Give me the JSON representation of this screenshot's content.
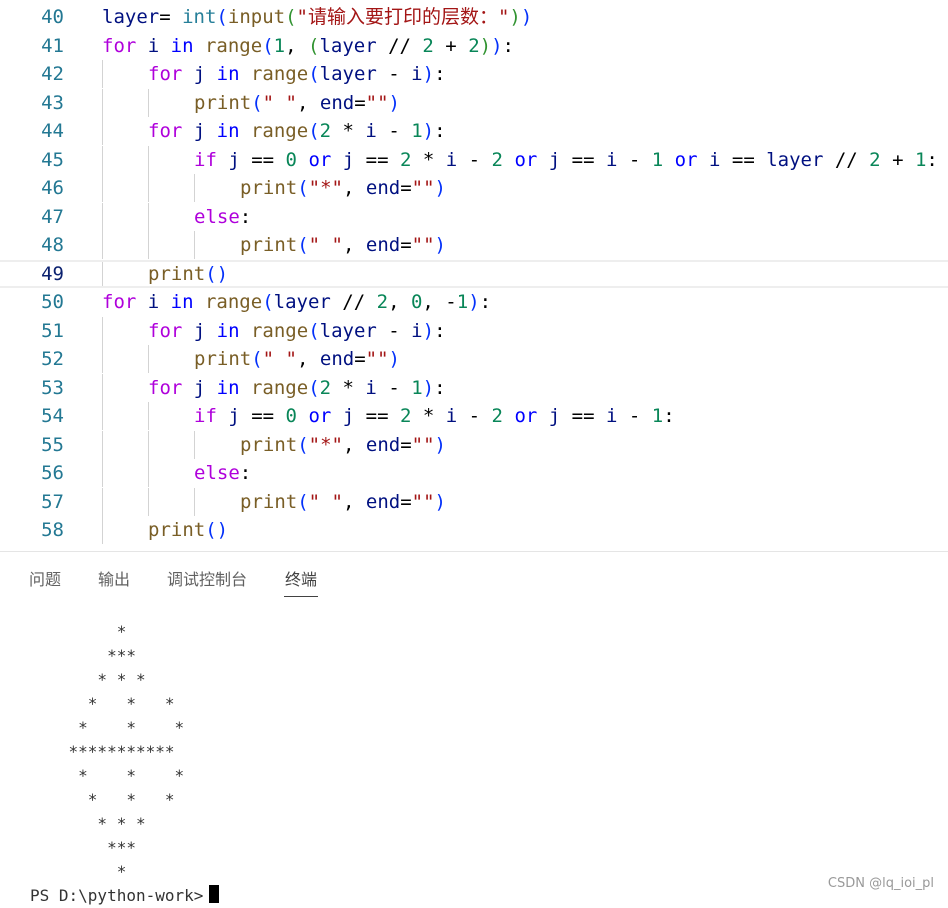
{
  "editor": {
    "current_line": "49",
    "lines": [
      {
        "n": "40",
        "indent": 0,
        "tokens": [
          [
            "vr",
            "layer"
          ],
          [
            "",
            "= "
          ],
          [
            "bi",
            "int"
          ],
          [
            "b1",
            "("
          ],
          [
            "fn",
            "input"
          ],
          [
            "b2",
            "("
          ],
          [
            "st",
            "\"请输入要打印的层数：\""
          ],
          [
            "b2",
            ")"
          ],
          [
            "b1",
            ")"
          ]
        ]
      },
      {
        "n": "41",
        "indent": 0,
        "tokens": [
          [
            "kw",
            "for "
          ],
          [
            "vr",
            "i "
          ],
          [
            "kf",
            "in "
          ],
          [
            "fn",
            "range"
          ],
          [
            "b1",
            "("
          ],
          [
            "nm",
            "1"
          ],
          [
            "",
            ", "
          ],
          [
            "b2",
            "("
          ],
          [
            "vr",
            "layer "
          ],
          [
            "",
            "// "
          ],
          [
            "nm",
            "2 "
          ],
          [
            "",
            "+ "
          ],
          [
            "nm",
            "2"
          ],
          [
            "b2",
            ")"
          ],
          [
            "b1",
            ")"
          ],
          [
            "",
            ":"
          ]
        ]
      },
      {
        "n": "42",
        "indent": 1,
        "tokens": [
          [
            "kw",
            "for "
          ],
          [
            "vr",
            "j "
          ],
          [
            "kf",
            "in "
          ],
          [
            "fn",
            "range"
          ],
          [
            "b1",
            "("
          ],
          [
            "vr",
            "layer "
          ],
          [
            "",
            "- "
          ],
          [
            "vr",
            "i"
          ],
          [
            "b1",
            ")"
          ],
          [
            "",
            ":"
          ]
        ]
      },
      {
        "n": "43",
        "indent": 2,
        "tokens": [
          [
            "fn",
            "print"
          ],
          [
            "b1",
            "("
          ],
          [
            "st",
            "\" \""
          ],
          [
            "",
            ", "
          ],
          [
            "vr",
            "end"
          ],
          [
            "",
            "="
          ],
          [
            "st",
            "\"\""
          ],
          [
            "b1",
            ")"
          ]
        ]
      },
      {
        "n": "44",
        "indent": 1,
        "tokens": [
          [
            "kw",
            "for "
          ],
          [
            "vr",
            "j "
          ],
          [
            "kf",
            "in "
          ],
          [
            "fn",
            "range"
          ],
          [
            "b1",
            "("
          ],
          [
            "nm",
            "2 "
          ],
          [
            "",
            "* "
          ],
          [
            "vr",
            "i "
          ],
          [
            "",
            "- "
          ],
          [
            "nm",
            "1"
          ],
          [
            "b1",
            ")"
          ],
          [
            "",
            ":"
          ]
        ]
      },
      {
        "n": "45",
        "indent": 2,
        "tokens": [
          [
            "kw",
            "if "
          ],
          [
            "vr",
            "j "
          ],
          [
            "",
            "== "
          ],
          [
            "nm",
            "0 "
          ],
          [
            "kf",
            "or "
          ],
          [
            "vr",
            "j "
          ],
          [
            "",
            "== "
          ],
          [
            "nm",
            "2 "
          ],
          [
            "",
            "* "
          ],
          [
            "vr",
            "i "
          ],
          [
            "",
            "- "
          ],
          [
            "nm",
            "2 "
          ],
          [
            "kf",
            "or "
          ],
          [
            "vr",
            "j "
          ],
          [
            "",
            "== "
          ],
          [
            "vr",
            "i "
          ],
          [
            "",
            "- "
          ],
          [
            "nm",
            "1 "
          ],
          [
            "kf",
            "or "
          ],
          [
            "vr",
            "i "
          ],
          [
            "",
            "== "
          ],
          [
            "vr",
            "layer "
          ],
          [
            "",
            "// "
          ],
          [
            "nm",
            "2 "
          ],
          [
            "",
            "+ "
          ],
          [
            "nm",
            "1"
          ],
          [
            "",
            ":"
          ]
        ]
      },
      {
        "n": "46",
        "indent": 3,
        "tokens": [
          [
            "fn",
            "print"
          ],
          [
            "b1",
            "("
          ],
          [
            "st",
            "\"*\""
          ],
          [
            "",
            ", "
          ],
          [
            "vr",
            "end"
          ],
          [
            "",
            "="
          ],
          [
            "st",
            "\"\""
          ],
          [
            "b1",
            ")"
          ]
        ]
      },
      {
        "n": "47",
        "indent": 2,
        "tokens": [
          [
            "kw",
            "else"
          ],
          [
            "",
            ":"
          ]
        ]
      },
      {
        "n": "48",
        "indent": 3,
        "tokens": [
          [
            "fn",
            "print"
          ],
          [
            "b1",
            "("
          ],
          [
            "st",
            "\" \""
          ],
          [
            "",
            ", "
          ],
          [
            "vr",
            "end"
          ],
          [
            "",
            "="
          ],
          [
            "st",
            "\"\""
          ],
          [
            "b1",
            ")"
          ]
        ]
      },
      {
        "n": "49",
        "indent": 1,
        "tokens": [
          [
            "fn",
            "print"
          ],
          [
            "b1",
            "()"
          ]
        ]
      },
      {
        "n": "50",
        "indent": 0,
        "tokens": [
          [
            "kw",
            "for "
          ],
          [
            "vr",
            "i "
          ],
          [
            "kf",
            "in "
          ],
          [
            "fn",
            "range"
          ],
          [
            "b1",
            "("
          ],
          [
            "vr",
            "layer "
          ],
          [
            "",
            "// "
          ],
          [
            "nm",
            "2"
          ],
          [
            "",
            ", "
          ],
          [
            "nm",
            "0"
          ],
          [
            "",
            ", "
          ],
          [
            "",
            "-"
          ],
          [
            "nm",
            "1"
          ],
          [
            "b1",
            ")"
          ],
          [
            "",
            ":"
          ]
        ]
      },
      {
        "n": "51",
        "indent": 1,
        "tokens": [
          [
            "kw",
            "for "
          ],
          [
            "vr",
            "j "
          ],
          [
            "kf",
            "in "
          ],
          [
            "fn",
            "range"
          ],
          [
            "b1",
            "("
          ],
          [
            "vr",
            "layer "
          ],
          [
            "",
            "- "
          ],
          [
            "vr",
            "i"
          ],
          [
            "b1",
            ")"
          ],
          [
            "",
            ":"
          ]
        ]
      },
      {
        "n": "52",
        "indent": 2,
        "tokens": [
          [
            "fn",
            "print"
          ],
          [
            "b1",
            "("
          ],
          [
            "st",
            "\" \""
          ],
          [
            "",
            ", "
          ],
          [
            "vr",
            "end"
          ],
          [
            "",
            "="
          ],
          [
            "st",
            "\"\""
          ],
          [
            "b1",
            ")"
          ]
        ]
      },
      {
        "n": "53",
        "indent": 1,
        "tokens": [
          [
            "kw",
            "for "
          ],
          [
            "vr",
            "j "
          ],
          [
            "kf",
            "in "
          ],
          [
            "fn",
            "range"
          ],
          [
            "b1",
            "("
          ],
          [
            "nm",
            "2 "
          ],
          [
            "",
            "* "
          ],
          [
            "vr",
            "i "
          ],
          [
            "",
            "- "
          ],
          [
            "nm",
            "1"
          ],
          [
            "b1",
            ")"
          ],
          [
            "",
            ":"
          ]
        ]
      },
      {
        "n": "54",
        "indent": 2,
        "tokens": [
          [
            "kw",
            "if "
          ],
          [
            "vr",
            "j "
          ],
          [
            "",
            "== "
          ],
          [
            "nm",
            "0 "
          ],
          [
            "kf",
            "or "
          ],
          [
            "vr",
            "j "
          ],
          [
            "",
            "== "
          ],
          [
            "nm",
            "2 "
          ],
          [
            "",
            "* "
          ],
          [
            "vr",
            "i "
          ],
          [
            "",
            "- "
          ],
          [
            "nm",
            "2 "
          ],
          [
            "kf",
            "or "
          ],
          [
            "vr",
            "j "
          ],
          [
            "",
            "== "
          ],
          [
            "vr",
            "i "
          ],
          [
            "",
            "- "
          ],
          [
            "nm",
            "1"
          ],
          [
            "",
            ":"
          ]
        ]
      },
      {
        "n": "55",
        "indent": 3,
        "tokens": [
          [
            "fn",
            "print"
          ],
          [
            "b1",
            "("
          ],
          [
            "st",
            "\"*\""
          ],
          [
            "",
            ", "
          ],
          [
            "vr",
            "end"
          ],
          [
            "",
            "="
          ],
          [
            "st",
            "\"\""
          ],
          [
            "b1",
            ")"
          ]
        ]
      },
      {
        "n": "56",
        "indent": 2,
        "tokens": [
          [
            "kw",
            "else"
          ],
          [
            "",
            ":"
          ]
        ]
      },
      {
        "n": "57",
        "indent": 3,
        "tokens": [
          [
            "fn",
            "print"
          ],
          [
            "b1",
            "("
          ],
          [
            "st",
            "\" \""
          ],
          [
            "",
            ", "
          ],
          [
            "vr",
            "end"
          ],
          [
            "",
            "="
          ],
          [
            "st",
            "\"\""
          ],
          [
            "b1",
            ")"
          ]
        ]
      },
      {
        "n": "58",
        "indent": 1,
        "tokens": [
          [
            "fn",
            "print"
          ],
          [
            "b1",
            "()"
          ]
        ]
      }
    ]
  },
  "panel": {
    "tabs": [
      {
        "label": "问题",
        "active": false
      },
      {
        "label": "输出",
        "active": false
      },
      {
        "label": "调试控制台",
        "active": false
      },
      {
        "label": "终端",
        "active": true
      }
    ]
  },
  "terminal": {
    "lines": [
      "         *",
      "        ***",
      "       * * *",
      "      *   *   *",
      "     *    *    *",
      "    ***********",
      "     *    *    *",
      "      *   *   *",
      "       * * *",
      "        ***",
      "         *"
    ],
    "prompt": "PS D:\\python-work>"
  },
  "watermark": "CSDN @lq_ioi_pl"
}
